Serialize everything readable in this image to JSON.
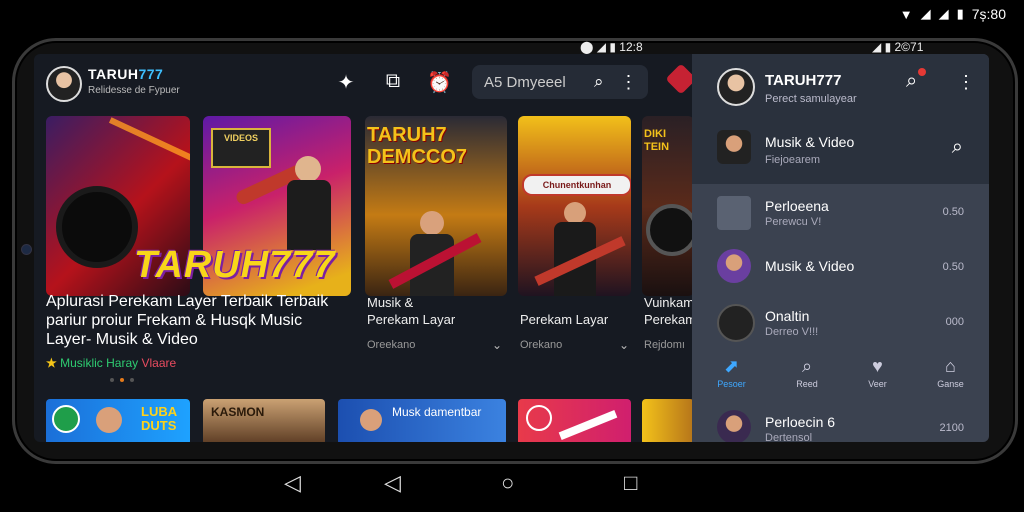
{
  "device_status": {
    "time": "7ș:80",
    "inner_time_left": "12:8",
    "inner_time_right": "2©71"
  },
  "app": {
    "brand": "TARUH777",
    "brand_main": "TARUH",
    "brand_num": "777",
    "brand_sub": "Relidesse de Fypuer",
    "search_placeholder": "A5 Dmyeeel",
    "hero": {
      "logo_text": "TARUH777",
      "description": "Aplurasi Perekam Layer Terbaik Terbaik pariur proiur Frekam & Husqk Music Layer- Musik & Video",
      "category": "Musiklic Haray",
      "category_suffix": "Vlaare"
    },
    "cards": [
      {
        "title_line1": "Musik &",
        "title_line2": "Perekam Layar",
        "meta": "Oreekano"
      },
      {
        "title_line1": "",
        "title_line2": "Perekam Layar",
        "meta": "Orekano"
      },
      {
        "title_line1": "Vuinkam",
        "title_line2": "Perekam",
        "meta": "Rejdomı"
      }
    ],
    "card_art_text": [
      "TARUH7 DEMCCO7",
      "Chunentkunhan",
      "VIDEOS",
      "DIKI TEIN"
    ],
    "bottom_strip": [
      {
        "label": "LUBA DUTS"
      },
      {
        "label": "KASMON"
      },
      {
        "label": "Musk damentbar"
      },
      {
        "label": ""
      },
      {
        "label": ""
      }
    ]
  },
  "panel": {
    "brand": "TARUH777",
    "brand_sub": "Perect samulayear",
    "featured": {
      "title": "Musik & Video",
      "sub": "Fiejoearem"
    },
    "rows": [
      {
        "title": "Perloeena",
        "sub": "Perewcu V!",
        "right": "0.50"
      },
      {
        "title": "Musik & Video",
        "sub": "",
        "right": "0.50"
      },
      {
        "title": "Onaltin",
        "sub": "Derreo V!!!",
        "right": "000"
      },
      {
        "title": "Perloecin 6",
        "sub": "Dertensol",
        "right": "2100"
      }
    ],
    "nav": [
      "Pesoer",
      "Reed",
      "Veer",
      "Ganse"
    ]
  },
  "colors": {
    "accent": "#3ea8ff",
    "brand_num": "#3ec0ff",
    "hero_gold": "#f8d61a",
    "panel_bg": "#3b4250"
  }
}
